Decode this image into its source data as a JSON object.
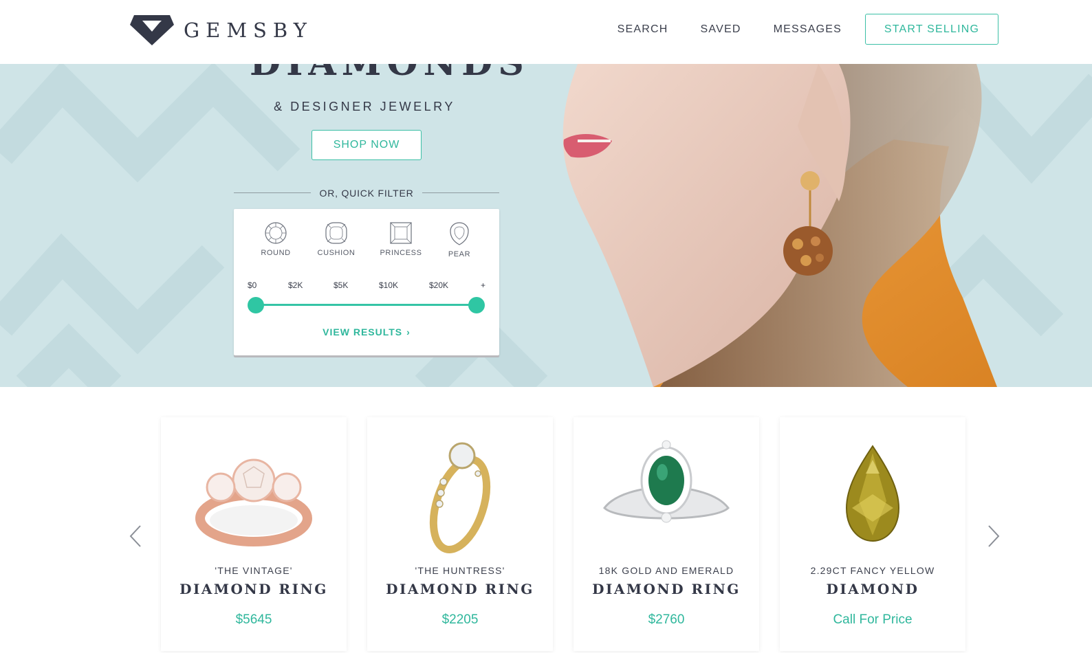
{
  "brand": {
    "name": "GEMSBY",
    "logo_icon": "gemsby-diamond-logo",
    "accent_color": "#2fb79c",
    "dark_color": "#343847"
  },
  "nav": {
    "links": [
      "SEARCH",
      "SAVED",
      "MESSAGES"
    ],
    "cta_label": "START SELLING"
  },
  "hero": {
    "title": "DIAMONDS",
    "subtitle": "& DESIGNER JEWELRY",
    "shop_button": "SHOP NOW",
    "quick_filter_label": "OR, QUICK FILTER",
    "background_color": "#cfe4e7",
    "shapes": [
      {
        "label": "ROUND",
        "icon": "round-cut-icon"
      },
      {
        "label": "CUSHION",
        "icon": "cushion-cut-icon"
      },
      {
        "label": "PRINCESS",
        "icon": "princess-cut-icon"
      },
      {
        "label": "PEAR",
        "icon": "pear-cut-icon"
      }
    ],
    "price_ticks": [
      "$0",
      "$2K",
      "$5K",
      "$10K",
      "$20K",
      "+"
    ],
    "price_range": {
      "min_label": "$0",
      "max_label": "+"
    },
    "view_results": "VIEW RESULTS"
  },
  "products": {
    "prev_icon": "chevron-left-icon",
    "next_icon": "chevron-right-icon",
    "items": [
      {
        "subtitle": "'THE VINTAGE'",
        "title": "DIAMOND RING",
        "price": "$5645",
        "image": "rose-gold-three-stone-ring"
      },
      {
        "subtitle": "'THE HUNTRESS'",
        "title": "DIAMOND RING",
        "price": "$2205",
        "image": "yellow-gold-solitaire-ring"
      },
      {
        "subtitle": "18K GOLD AND EMERALD",
        "title": "DIAMOND RING",
        "price": "$2760",
        "image": "emerald-halo-ring"
      },
      {
        "subtitle": "2.29CT FANCY YELLOW",
        "title": "DIAMOND",
        "price": "Call For Price",
        "image": "yellow-pear-diamond"
      }
    ]
  }
}
